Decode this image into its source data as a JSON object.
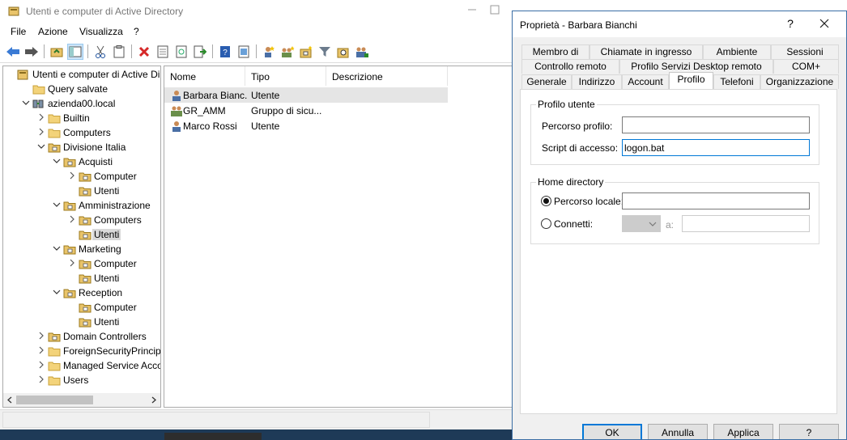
{
  "main_window": {
    "title": "Utenti e computer di Active Directory",
    "menu": [
      "File",
      "Azione",
      "Visualizza",
      "?"
    ]
  },
  "tree": {
    "items": [
      {
        "label": "Utenti e computer di Active Direct",
        "icon": "aduc-root-icon"
      },
      {
        "label": "Query salvate",
        "icon": "folder-icon"
      },
      {
        "label": "azienda00.local",
        "icon": "domain-icon"
      },
      {
        "label": "Builtin",
        "icon": "folder-icon"
      },
      {
        "label": "Computers",
        "icon": "folder-icon"
      },
      {
        "label": "Divisione Italia",
        "icon": "ou-icon"
      },
      {
        "label": "Acquisti",
        "icon": "ou-icon"
      },
      {
        "label": "Computer",
        "icon": "ou-icon"
      },
      {
        "label": "Utenti",
        "icon": "ou-icon"
      },
      {
        "label": "Amministrazione",
        "icon": "ou-icon"
      },
      {
        "label": "Computers",
        "icon": "ou-icon"
      },
      {
        "label": "Utenti",
        "icon": "ou-icon",
        "selected": true
      },
      {
        "label": "Marketing",
        "icon": "ou-icon"
      },
      {
        "label": "Computer",
        "icon": "ou-icon"
      },
      {
        "label": "Utenti",
        "icon": "ou-icon"
      },
      {
        "label": "Reception",
        "icon": "ou-icon"
      },
      {
        "label": "Computer",
        "icon": "ou-icon"
      },
      {
        "label": "Utenti",
        "icon": "ou-icon"
      },
      {
        "label": "Domain Controllers",
        "icon": "ou-icon"
      },
      {
        "label": "ForeignSecurityPrincipals",
        "icon": "folder-icon"
      },
      {
        "label": "Managed Service Accoun",
        "icon": "folder-icon"
      },
      {
        "label": "Users",
        "icon": "folder-icon"
      }
    ]
  },
  "list": {
    "columns": [
      "Nome",
      "Tipo",
      "Descrizione"
    ],
    "rows": [
      {
        "name": "Barbara Bianc...",
        "type": "Utente",
        "icon": "user-icon"
      },
      {
        "name": "GR_AMM",
        "type": "Gruppo di sicu...",
        "icon": "group-icon"
      },
      {
        "name": "Marco Rossi",
        "type": "Utente",
        "icon": "user-icon"
      }
    ]
  },
  "dialog": {
    "title": "Proprietà - Barbara Bianchi",
    "help": "?",
    "tabs_row1": [
      "Membro di",
      "Chiamate in ingresso",
      "Ambiente",
      "Sessioni"
    ],
    "tabs_row2": [
      "Controllo remoto",
      "Profilo Servizi Desktop remoto",
      "COM+"
    ],
    "tabs_row3": [
      "Generale",
      "Indirizzo",
      "Account",
      "Profilo",
      "Telefoni",
      "Organizzazione"
    ],
    "active_tab": "Profilo",
    "profile_group": {
      "title": "Profilo utente",
      "profile_path_label": "Percorso profilo:",
      "profile_path_value": "",
      "logon_script_label": "Script di accesso:",
      "logon_script_value": "logon.bat"
    },
    "home_group": {
      "title": "Home directory",
      "local_path_label": "Percorso locale:",
      "local_path_value": "",
      "connect_label": "Connetti:",
      "to_label": "a:",
      "connect_path_value": ""
    },
    "buttons": {
      "ok": "OK",
      "cancel": "Annulla",
      "apply": "Applica",
      "help": "?"
    }
  }
}
